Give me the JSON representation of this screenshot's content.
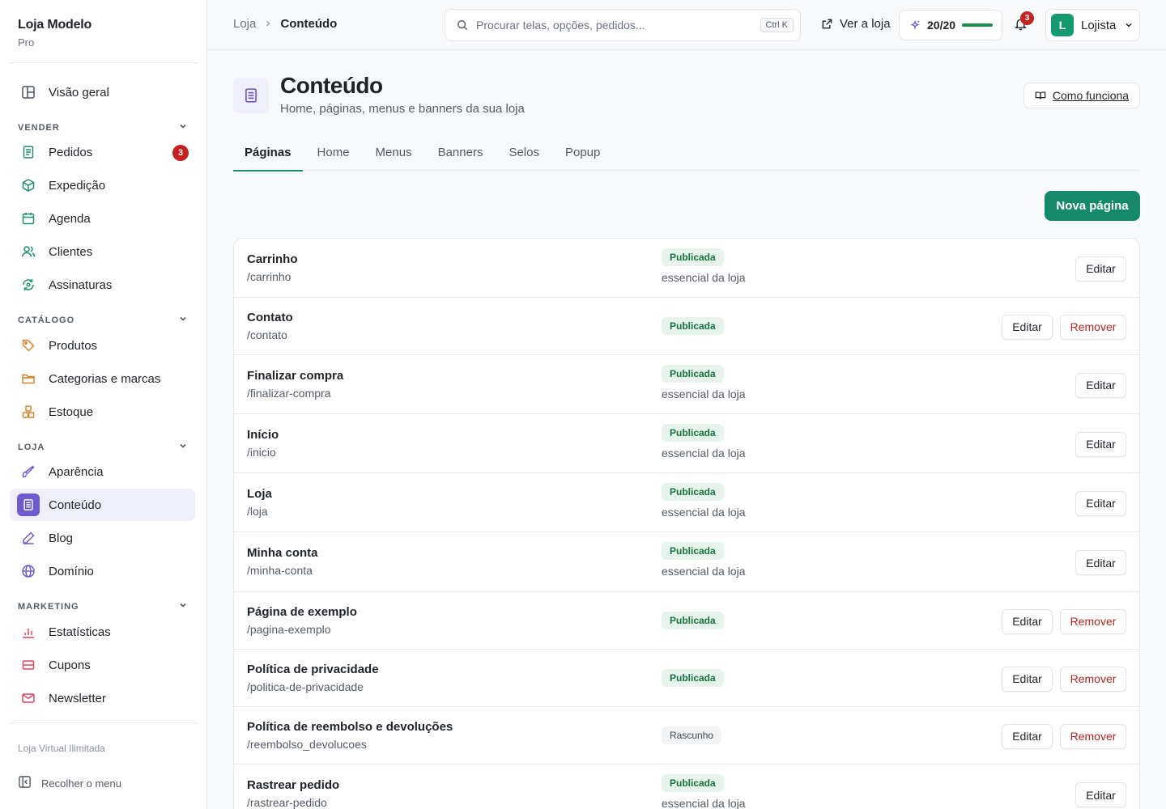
{
  "brand": {
    "name": "Loja Modelo",
    "plan": "Pro"
  },
  "sidebar": {
    "overview": "Visão geral",
    "sections": {
      "sell": "VENDER",
      "catalog": "CATÁLOGO",
      "store": "LOJA",
      "marketing": "MARKETING"
    },
    "items": {
      "orders": {
        "label": "Pedidos",
        "badge": "3"
      },
      "shipping": "Expedição",
      "schedule": "Agenda",
      "customers": "Clientes",
      "subscriptions": "Assinaturas",
      "products": "Produtos",
      "categories": "Categorias e marcas",
      "stock": "Estoque",
      "appearance": "Aparência",
      "content": "Conteúdo",
      "blog": "Blog",
      "domain": "Domínio",
      "stats": "Estatísticas",
      "coupons": "Cupons",
      "newsletter": "Newsletter"
    },
    "footer_note": "Loja Virtual Ilimitada",
    "collapse_label": "Recolher o menu"
  },
  "topbar": {
    "breadcrumb": [
      "Loja",
      "Conteúdo"
    ],
    "search_placeholder": "Procurar telas, opções, pedidos...",
    "search_shortcut": "Ctrl K",
    "view_store": "Ver a loja",
    "quota": {
      "text": "20/20",
      "fraction": 1.0
    },
    "notifications_count": "3",
    "user": {
      "initial": "L",
      "name": "Lojista"
    }
  },
  "page": {
    "title": "Conteúdo",
    "subtitle": "Home, páginas, menus e banners da sua loja",
    "how_it_works": "Como funciona",
    "tabs": [
      "Páginas",
      "Home",
      "Menus",
      "Banners",
      "Selos",
      "Popup"
    ],
    "active_tab": 0,
    "new_button": "Nova página"
  },
  "labels": {
    "edit": "Editar",
    "remove": "Remover"
  },
  "pages": [
    {
      "name": "Carrinho",
      "slug": "/carrinho",
      "status": "Publicada",
      "published": true,
      "note": "essencial da loja",
      "removable": false
    },
    {
      "name": "Contato",
      "slug": "/contato",
      "status": "Publicada",
      "published": true,
      "note": "",
      "removable": true
    },
    {
      "name": "Finalizar compra",
      "slug": "/finalizar-compra",
      "status": "Publicada",
      "published": true,
      "note": "essencial da loja",
      "removable": false
    },
    {
      "name": "Início",
      "slug": "/inicio",
      "status": "Publicada",
      "published": true,
      "note": "essencial da loja",
      "removable": false
    },
    {
      "name": "Loja",
      "slug": "/loja",
      "status": "Publicada",
      "published": true,
      "note": "essencial da loja",
      "removable": false
    },
    {
      "name": "Minha conta",
      "slug": "/minha-conta",
      "status": "Publicada",
      "published": true,
      "note": "essencial da loja",
      "removable": false
    },
    {
      "name": "Página de exemplo",
      "slug": "/pagina-exemplo",
      "status": "Publicada",
      "published": true,
      "note": "",
      "removable": true
    },
    {
      "name": "Política de privacidade",
      "slug": "/politica-de-privacidade",
      "status": "Publicada",
      "published": true,
      "note": "",
      "removable": true
    },
    {
      "name": "Política de reembolso e devoluções",
      "slug": "/reembolso_devolucoes",
      "status": "Rascunho",
      "published": false,
      "note": "",
      "removable": true
    },
    {
      "name": "Rastrear pedido",
      "slug": "/rastrear-pedido",
      "status": "Publicada",
      "published": true,
      "note": "essencial da loja",
      "removable": false
    }
  ]
}
